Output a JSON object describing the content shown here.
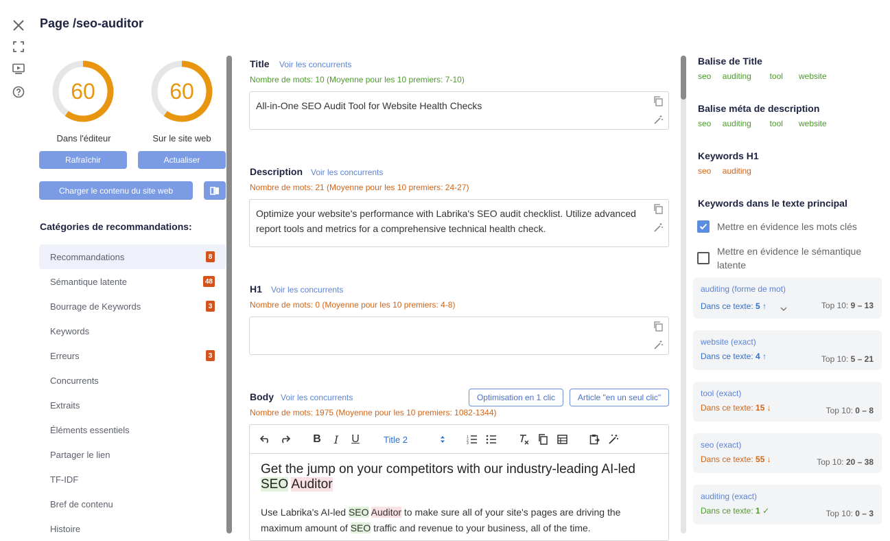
{
  "page_title": "Page /seo-auditor",
  "gauges": [
    {
      "value": "60",
      "label": "Dans l'éditeur",
      "fraction": 0.6
    },
    {
      "value": "60",
      "label": "Sur le site web",
      "fraction": 0.6
    }
  ],
  "buttons": {
    "refresh": "Rafraîchir",
    "update": "Actualiser",
    "load_content": "Charger le contenu du site web"
  },
  "categories": {
    "title": "Catégories de recommandations:",
    "items": [
      {
        "label": "Recommandations",
        "badge": "8"
      },
      {
        "label": "Sémantique latente",
        "badge": "48"
      },
      {
        "label": "Bourrage de Keywords",
        "badge": "3"
      },
      {
        "label": "Keywords",
        "badge": ""
      },
      {
        "label": "Erreurs",
        "badge": "3"
      },
      {
        "label": "Concurrents",
        "badge": ""
      },
      {
        "label": "Extraits",
        "badge": ""
      },
      {
        "label": "Éléments essentiels",
        "badge": ""
      },
      {
        "label": "Partager le lien",
        "badge": ""
      },
      {
        "label": "TF-IDF",
        "badge": ""
      },
      {
        "label": "Bref de contenu",
        "badge": ""
      },
      {
        "label": "Histoire",
        "badge": ""
      }
    ]
  },
  "sections": {
    "title": {
      "label": "Title",
      "competitors_link": "Voir les concurrents",
      "word_count": "Nombre de mots: 10 (Moyenne pour les 10 premiers: 7-10)",
      "value": "All-in-One SEO Audit Tool for Website Health Checks"
    },
    "description": {
      "label": "Description",
      "competitors_link": "Voir les concurrents",
      "word_count": "Nombre de mots: 21 (Moyenne pour les 10 premiers: 24-27)",
      "value": "Optimize your website's performance with Labrika's SEO audit checklist. Utilize advanced report tools and metrics for a comprehensive technical health check."
    },
    "h1": {
      "label": "H1",
      "competitors_link": "Voir les concurrents",
      "word_count": "Nombre de mots: 0 (Moyenne pour les 10 premiers: 4-8)",
      "value": ""
    },
    "body": {
      "label": "Body",
      "competitors_link": "Voir les concurrents",
      "word_count": "Nombre de mots: 1975 (Moyenne pour les 10 premiers: 1082-1344)",
      "optimize_button": "Optimisation en 1 clic",
      "article_button": "Article \"en un seul clic\"",
      "style_select": "Title 2",
      "heading_before": "Get the jump on your competitors with our industry-leading AI-led ",
      "heading_hl1": "SEO",
      "heading_space": " ",
      "heading_hl2": "Auditor",
      "p_part1": "Use Labrika's AI-led ",
      "p_hl1": "SEO",
      "p_space": " ",
      "p_hl2": "Auditor",
      "p_part2": " to make sure all of your site's pages are driving the maximum amount of ",
      "p_hl3": "SEO",
      "p_part3": " traffic and revenue to your business, all of the time."
    }
  },
  "right": {
    "title_tag": {
      "heading": "Balise de Title",
      "tags": [
        "seo",
        "auditing",
        "tool",
        "website"
      ]
    },
    "meta_desc": {
      "heading": "Balise méta de description",
      "tags": [
        "seo",
        "auditing",
        "tool",
        "website"
      ]
    },
    "h1_keywords": {
      "heading": "Keywords H1",
      "tags": [
        "seo",
        "auditing"
      ]
    },
    "main_text": {
      "heading": "Keywords dans le texte principal",
      "highlight_keywords": {
        "label": "Mettre en évidence les mots clés",
        "checked": true
      },
      "highlight_semantic": {
        "label": "Mettre en évidence le sémantique latente",
        "checked": false
      }
    },
    "keyword_cards": [
      {
        "name": "auditing (forme de mot)",
        "count_label": "Dans ce texte: ",
        "count": "5",
        "trend": "↑",
        "status": "blue",
        "top_label": "Top 10: ",
        "top": "9 – 13",
        "expand": true
      },
      {
        "name": "website (exact)",
        "count_label": "Dans ce texte: ",
        "count": "4",
        "trend": "↑",
        "status": "blue",
        "top_label": "Top 10: ",
        "top": "5 – 21",
        "expand": false
      },
      {
        "name": "tool (exact)",
        "count_label": "Dans ce texte: ",
        "count": "15",
        "trend": "↓",
        "status": "orange",
        "top_label": "Top 10: ",
        "top": "0 – 8",
        "expand": false
      },
      {
        "name": "seo (exact)",
        "count_label": "Dans ce texte: ",
        "count": "55",
        "trend": "↓",
        "status": "orange",
        "top_label": "Top 10: ",
        "top": "20 – 38",
        "expand": false
      },
      {
        "name": "auditing (exact)",
        "count_label": "Dans ce texte: ",
        "count": "1",
        "trend": "✓",
        "status": "green",
        "top_label": "Top 10: ",
        "top": "0 – 3",
        "expand": false
      }
    ]
  },
  "colors": {
    "accent": "#7b9be5",
    "gauge": "#e8960f",
    "badge": "#d4521b",
    "green": "#4b9a2a",
    "orange": "#d06417"
  }
}
